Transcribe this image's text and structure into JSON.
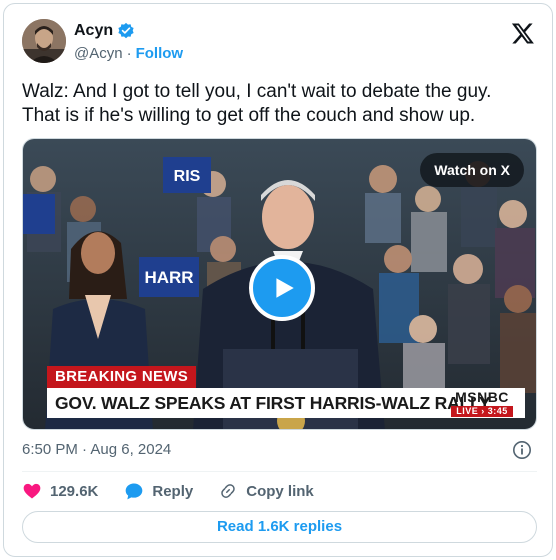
{
  "author": {
    "display_name": "Acyn",
    "handle": "@Acyn",
    "separator": "·",
    "follow_label": "Follow",
    "verified": true
  },
  "tweet": {
    "text": "Walz: And I got to tell you, I can't wait to debate the guy.\nThat is if he's willing to get off the couch and show up.",
    "timestamp": "6:50 PM · Aug 6, 2024"
  },
  "media": {
    "watch_label": "Watch on X",
    "breaking_label": "BREAKING NEWS",
    "chyron": "GOV. WALZ SPEAKS AT FIRST HARRIS-WALZ RALLY",
    "network": "MSNBC",
    "live_label": "LIVE",
    "live_time": "3:45",
    "sign_left": "RIS",
    "sign_mid": "HARR"
  },
  "actions": {
    "like_count": "129.6K",
    "reply_label": "Reply",
    "copy_label": "Copy link"
  },
  "read_replies_label": "Read 1.6K replies",
  "colors": {
    "accent": "#1d9bf0",
    "like": "#f91880",
    "breaking_red": "#c4161c",
    "text_secondary": "#536471"
  },
  "icons": {
    "verified": "verified-badge-icon",
    "x_logo": "x-logo-icon",
    "play": "play-icon",
    "info": "info-icon",
    "heart": "heart-icon",
    "reply": "reply-bubble-icon",
    "link": "link-icon"
  }
}
